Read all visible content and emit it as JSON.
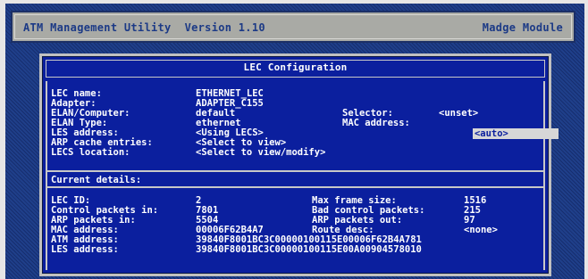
{
  "app": {
    "title": "ATM Management Utility  Version 1.10",
    "module": "Madge Module"
  },
  "dialog": {
    "title": "LEC Configuration",
    "config": {
      "lec_name_label": "LEC name:",
      "lec_name": "ETHERNET_LEC",
      "adapter_label": "Adapter:",
      "adapter": "ADAPTER_C155",
      "elan_computer_label": "ELAN/Computer:",
      "elan_computer": "default",
      "selector_label": "Selector:",
      "selector": "<unset>",
      "elan_type_label": "ELAN Type:",
      "elan_type": "ethernet",
      "mac_address_label": "MAC address:",
      "mac_address": "<auto>",
      "les_address_label": "LES address:",
      "les_address": "<Using LECS>",
      "arp_cache_label": "ARP cache entries:",
      "arp_cache": "<Select to view>",
      "lecs_location_label": "LECS location:",
      "lecs_location": "<Select to view/modify>"
    },
    "current_details_heading": "Current details:",
    "details": {
      "lec_id_label": "LEC ID:",
      "lec_id": "2",
      "max_frame_label": "Max frame size:",
      "max_frame": "1516",
      "control_in_label": "Control packets in:",
      "control_in": "7801",
      "bad_control_label": "Bad control packets:",
      "bad_control": "215",
      "arp_in_label": "ARP packets in:",
      "arp_in": "5504",
      "arp_out_label": "ARP packets out:",
      "arp_out": "97",
      "mac_address_label": "MAC address:",
      "mac_address": "00006F62B4A7",
      "route_desc_label": "Route desc:",
      "route_desc": "<none>",
      "atm_address_label": "ATM address:",
      "atm_address": "39840F8001BC3C00000100115E00006F62B4A781",
      "les_address_label": "LES address:",
      "les_address": "39840F8001BC3C00000100115E00A00904578010"
    }
  }
}
